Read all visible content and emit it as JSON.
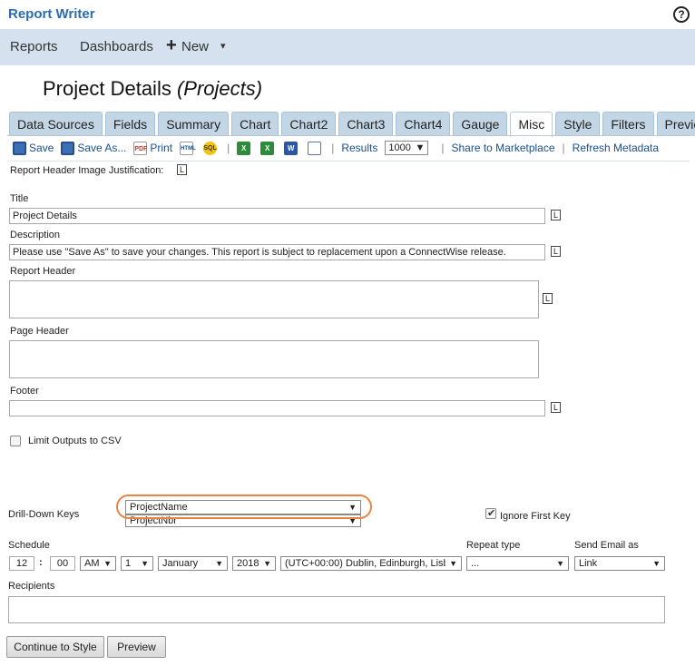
{
  "app": {
    "title": "Report Writer",
    "help_icon": "?"
  },
  "nav": {
    "items": [
      "Reports",
      "Dashboards"
    ],
    "new_label": "New",
    "plus": "+",
    "caret": "▾"
  },
  "page": {
    "title": "Project Details",
    "subtitle": "(Projects)"
  },
  "tabs": [
    {
      "label": "Data Sources"
    },
    {
      "label": "Fields"
    },
    {
      "label": "Summary"
    },
    {
      "label": "Chart"
    },
    {
      "label": "Chart2"
    },
    {
      "label": "Chart3"
    },
    {
      "label": "Chart4"
    },
    {
      "label": "Gauge"
    },
    {
      "label": "Misc",
      "active": true
    },
    {
      "label": "Style"
    },
    {
      "label": "Filters"
    },
    {
      "label": "Preview"
    }
  ],
  "toolbar": {
    "save": "Save",
    "save_as": "Save As...",
    "print": "Print",
    "results": "Results",
    "results_value": "1000",
    "share": "Share to Marketplace",
    "refresh": "Refresh Metadata",
    "sep": "|",
    "icons": {
      "pdf": "PDF",
      "html": "HTML",
      "sql": "SQL",
      "xls": "X",
      "word": "W"
    }
  },
  "form": {
    "header_image_label": "Report Header Image Justification:",
    "l_label": "L",
    "title_label": "Title",
    "title_value": "Project Details",
    "description_label": "Description",
    "description_value": "Please use \"Save As\" to save your changes.  This report is subject to replacement upon a ConnectWise release.",
    "report_header_label": "Report Header",
    "page_header_label": "Page Header",
    "footer_label": "Footer",
    "limit_csv_label": "Limit Outputs to CSV",
    "limit_csv_checked": false,
    "drilldown_label": "Drill-Down Keys",
    "drilldown_key1": "ProjectName",
    "drilldown_key2": "ProjectNbr",
    "ignore_first_key_label": "Ignore First Key",
    "ignore_first_key_checked": true,
    "schedule_label": "Schedule",
    "hour": "12",
    "colon": ":",
    "minute": "00",
    "ampm": "AM",
    "day": "1",
    "month": "January",
    "year": "2018",
    "timezone": "(UTC+00:00) Dublin, Edinburgh, Lisb",
    "repeat_type_label": "Repeat type",
    "repeat_type_value": "...",
    "send_email_label": "Send Email as",
    "send_email_value": "Link",
    "recipients_label": "Recipients",
    "recipients_value": ""
  },
  "buttons": {
    "continue": "Continue to Style",
    "preview": "Preview"
  },
  "colors": {
    "accent": "#2b6cb0",
    "navbar": "#d5e1ee",
    "tab": "#c3d6e6",
    "highlight": "#e8843f"
  }
}
